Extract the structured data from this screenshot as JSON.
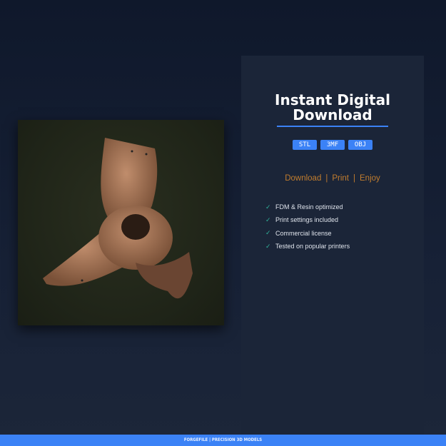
{
  "product_image": {
    "alt_label": "3D printed model render",
    "model_color": "#a8775a"
  },
  "panel": {
    "title_line1": "Instant Digital",
    "title_line2": "Download",
    "formats": [
      "STL",
      "3MF",
      "OBJ"
    ],
    "tagline": [
      "Download",
      "Print",
      "Enjoy"
    ],
    "tagline_separator": "|",
    "features": [
      "FDM & Resin optimized",
      "Print settings included",
      "Commercial license",
      "Tested on popular printers"
    ],
    "check_icon": "✓"
  },
  "footer": {
    "text": "FORGEFILE | PRECISION 3D MODELS"
  },
  "colors": {
    "accent": "#3b82f6",
    "tagline": "#c27d2e",
    "check": "#2fb39a"
  }
}
